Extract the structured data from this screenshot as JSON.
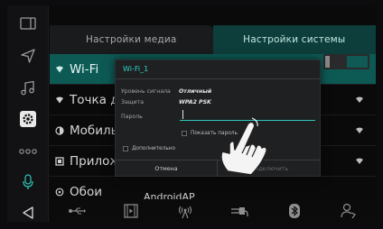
{
  "tabs": {
    "media": "Настройки медиа",
    "system": "Настройки системы"
  },
  "list": {
    "items": [
      {
        "label": "Wi-Fi"
      },
      {
        "label": "Точка дос"
      },
      {
        "label": "Мобильн"
      },
      {
        "label": "Приложе"
      },
      {
        "label": "Обои"
      }
    ],
    "extra": "AndroidAP"
  },
  "dialog": {
    "title": "Wi-Fi_1",
    "signal_key": "Уровень сигнала",
    "signal_val": "Отличный",
    "security_key": "Защита",
    "security_val": "WPA2 PSK",
    "password_key": "Пароль",
    "show_password": "Показать пароль",
    "advanced": "Дополнительно",
    "cancel": "Отмена",
    "connect": "Подключить"
  },
  "icons": {
    "rail": [
      "split-screen-icon",
      "navigation-icon",
      "music-icon",
      "settings-icon",
      "more-icon",
      "microphone-icon",
      "back-icon"
    ],
    "bottom": [
      "usb-icon",
      "video-icon",
      "radio-icon",
      "aux-icon",
      "bluetooth-icon",
      "phone-icon"
    ]
  },
  "colors": {
    "accent": "#2ed3c4",
    "active_row": "#0d5a55",
    "tab_active": "#0e3e3b"
  }
}
